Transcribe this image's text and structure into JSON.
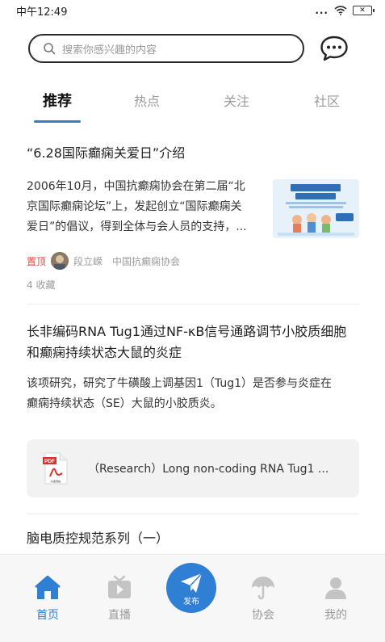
{
  "status_bar": {
    "time": "中午12:49",
    "dots": "...",
    "battery_label": "✕"
  },
  "search": {
    "placeholder": "搜索你感兴趣的内容"
  },
  "tabs": [
    {
      "label": "推荐"
    },
    {
      "label": "热点"
    },
    {
      "label": "关注"
    },
    {
      "label": "社区"
    }
  ],
  "articles": [
    {
      "title": "“6.28国际癫痫关爱日”介绍",
      "body_lines": [
        "2006年10月，中国抗癫痫协会在第二届“北",
        "京国际癫痫论坛”上，发起创立“国际癫痫关",
        "爱日”的倡议，得到全体与会人员的支持，..."
      ],
      "tag": "置顶",
      "author": "段立嵘",
      "source": "中国抗癫痫协会",
      "favorites": "4 收藏"
    },
    {
      "title_lines": [
        "长非编码RNA Tug1通过NF-κB信号通路调节小胶质细胞",
        "和癫痫持续状态大鼠的炎症"
      ],
      "body_lines": [
        "该项研究，研究了牛磺酸上调基因1（Tug1）是否参与炎症在",
        "癫痫持续状态（SE）大鼠的小胶质炎。"
      ],
      "attachment": {
        "icon": "pdf-icon",
        "icon_label": "PDF",
        "icon_sub": "Adobe",
        "name": "（Research）Long non-coding RNA Tug1 ..."
      }
    },
    {
      "title": "脑电质控规范系列（一）"
    }
  ],
  "bottom_nav": [
    {
      "label": "首页",
      "icon": "home-icon",
      "active": true
    },
    {
      "label": "直播",
      "icon": "tv-icon",
      "active": false
    },
    {
      "label": "发布",
      "icon": "paper-plane-icon",
      "active": false
    },
    {
      "label": "协会",
      "icon": "umbrella-icon",
      "active": false
    },
    {
      "label": "我的",
      "icon": "user-icon",
      "active": false
    }
  ],
  "colors": {
    "accent": "#2f7fd4",
    "pin": "#e0483e",
    "muted": "#9a9a9a"
  }
}
